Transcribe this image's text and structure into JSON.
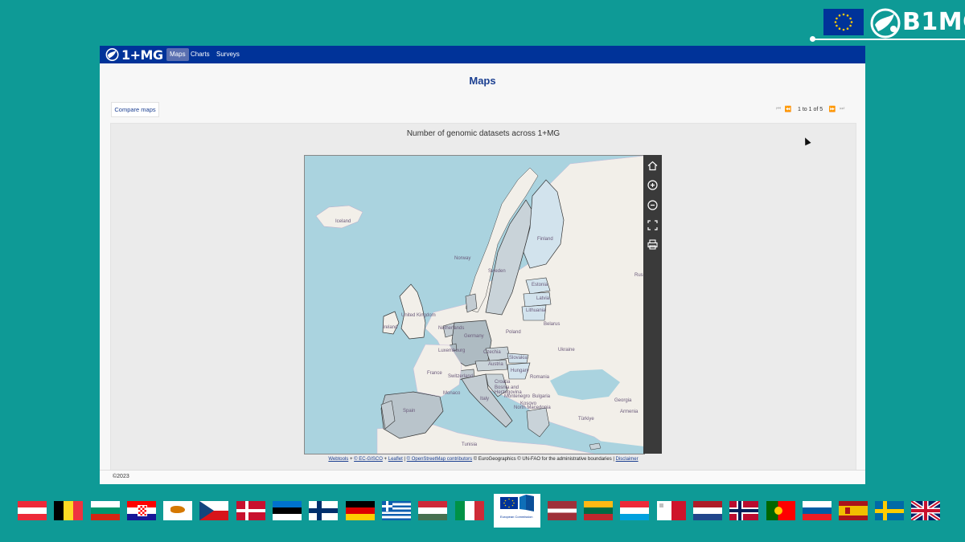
{
  "branding": {
    "org_name": "B1MG"
  },
  "navbar": {
    "logo_text": "1+MG",
    "items": [
      {
        "label": "Maps",
        "active": true
      },
      {
        "label": "Charts",
        "active": false
      },
      {
        "label": "Surveys",
        "active": false
      }
    ]
  },
  "page": {
    "title": "Maps",
    "compare_button": "Compare maps",
    "pager_text": "1 to 1 of 5"
  },
  "map": {
    "title": "Number of genomic datasets across 1+MG",
    "labels": {
      "iceland": "Iceland",
      "norway": "Norway",
      "sweden": "Sweden",
      "finland": "Finland",
      "estonia": "Estonia",
      "latvia": "Latvia",
      "lithuania": "Lithuania",
      "belarus": "Belarus",
      "poland": "Poland",
      "germany": "Germany",
      "czechia": "Czechia",
      "slovakia": "Slovakia",
      "austria": "Austria",
      "hungary": "Hungary",
      "romania": "Romania",
      "ukraine": "Ukraine",
      "france": "France",
      "switzerland": "Switzerland",
      "italy": "Italy",
      "spain": "Spain",
      "ireland": "Ireland",
      "uk": "United Kingdom",
      "netherlands": "Netherlands",
      "luxembourg": "Luxembourg",
      "monaco": "Monaco",
      "croatia": "Croatia",
      "bosnia": "Bosnia and Herzegovina",
      "montenegro": "Montenegro",
      "kosovo": "Kosovo",
      "north_macedonia": "North Macedonia",
      "bulgaria": "Bulgaria",
      "georgia": "Georgia",
      "armenia": "Armenia",
      "turkiye": "Türkiye",
      "tunisia": "Tunisia",
      "russia_partial": "Rus"
    },
    "tools": [
      "home-icon",
      "zoom-in-icon",
      "zoom-out-icon",
      "fullscreen-icon",
      "print-icon"
    ],
    "attribution": {
      "webtools": "Webtools",
      "plus1": " + ",
      "ecgisco": "© EC-GISCO",
      "plus2": " + ",
      "leaflet": "Leaflet",
      "sep1": " | ",
      "osm": "© OpenStreetMap contributors",
      "rest": " © EuroGeographics © UN-FAO for the administrative boundaries | ",
      "disclaimer": "Disclaimer"
    }
  },
  "footer": {
    "copyright": "©2023"
  },
  "flags_bottom": {
    "ec_text": "European Commission"
  },
  "colors": {
    "background": "#0e9a96",
    "navbar": "#003399",
    "sea": "#aad3df",
    "highlight_light": "#c9dde6",
    "highlight_dark": "#aebbc2"
  }
}
